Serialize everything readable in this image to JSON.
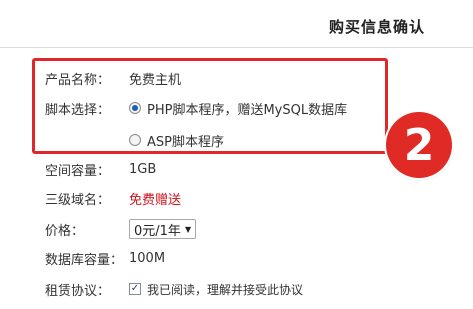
{
  "header": {
    "title": "购买信息确认"
  },
  "product": {
    "label": "产品名称：",
    "value": "免费主机"
  },
  "script": {
    "label": "脚本选择：",
    "options": [
      {
        "text": "PHP脚本程序，赠送MySQL数据库",
        "checked": true
      },
      {
        "text": "ASP脚本程序",
        "checked": false
      }
    ]
  },
  "badge": {
    "text": "2"
  },
  "space": {
    "label": "空间容量：",
    "value": "1GB"
  },
  "domain": {
    "label": "三级域名：",
    "value": "免费赠送"
  },
  "price": {
    "label": "价格：",
    "selected": "0元/1年"
  },
  "db": {
    "label": "数据库容量：",
    "value": "100M"
  },
  "lease": {
    "label": "租赁协议：",
    "text": "我已阅读，理解并接受此协议",
    "checked": true
  },
  "colors": {
    "highlight": "#e0282a",
    "badge": "#e02a25",
    "free_text": "#d0121b"
  }
}
